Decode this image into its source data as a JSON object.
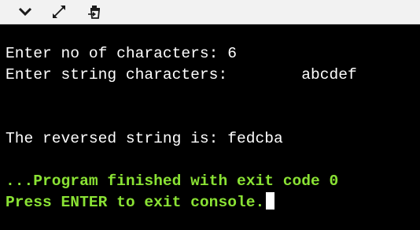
{
  "toolbar": {
    "buttons": [
      {
        "name": "collapse",
        "icon": "chevron-down-icon"
      },
      {
        "name": "expand",
        "icon": "expand-arrows-icon"
      },
      {
        "name": "clear",
        "icon": "clear-console-icon"
      }
    ]
  },
  "console": {
    "prompt_count_label": "Enter no of characters: ",
    "prompt_count_value": "6",
    "prompt_string_label": "Enter string characters:        ",
    "prompt_string_value": "abcdef",
    "result_label": "The reversed string is: ",
    "result_value": "fedcba",
    "exit_message": "...Program finished with exit code 0",
    "enter_message": "Press ENTER to exit console."
  },
  "colors": {
    "background": "#000000",
    "output_text": "#ffffff",
    "status_text": "#8ae234"
  }
}
